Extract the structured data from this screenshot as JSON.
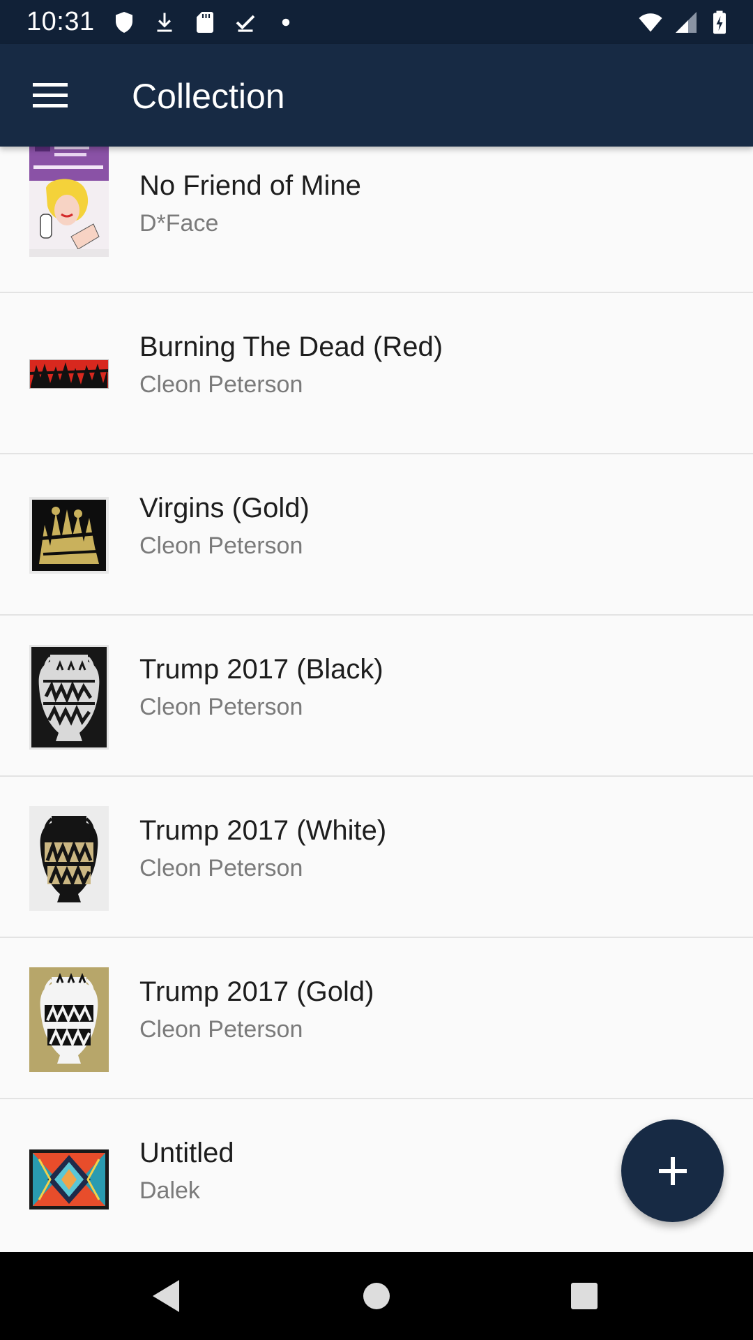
{
  "status_bar": {
    "time": "10:31",
    "left_icons": [
      "shield-icon",
      "download-icon",
      "sd-card-icon",
      "check-download-icon",
      "dot-icon"
    ],
    "right_icons": [
      "wifi-icon",
      "signal-icon",
      "battery-charging-icon"
    ]
  },
  "app_bar": {
    "title": "Collection",
    "menu_icon": "hamburger-menu-icon",
    "background_color": "#172a44"
  },
  "items": [
    {
      "title": "No Friend of Mine",
      "artist": "D*Face",
      "thumbnail": "comic-woman-phone-print"
    },
    {
      "title": "Burning The Dead (Red)",
      "artist": "Cleon Peterson",
      "thumbnail": "red-black-figures-print"
    },
    {
      "title": "Virgins (Gold)",
      "artist": "Cleon Peterson",
      "thumbnail": "gold-black-figures-print"
    },
    {
      "title": "Trump 2017 (Black)",
      "artist": "Cleon Peterson",
      "thumbnail": "black-vase-print"
    },
    {
      "title": "Trump 2017 (White)",
      "artist": "Cleon Peterson",
      "thumbnail": "white-vase-print"
    },
    {
      "title": "Trump 2017 (Gold)",
      "artist": "Cleon Peterson",
      "thumbnail": "gold-vase-print"
    },
    {
      "title": "Untitled",
      "artist": "Dalek",
      "thumbnail": "geometric-colorful-print"
    }
  ],
  "fab": {
    "icon": "plus-icon"
  },
  "nav_bar": {
    "buttons": [
      "back-icon",
      "home-icon",
      "recents-icon"
    ]
  }
}
